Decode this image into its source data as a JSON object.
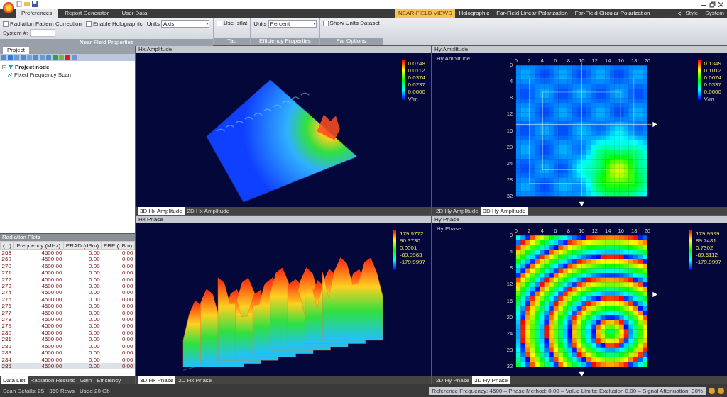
{
  "ribbon": {
    "tabs": [
      {
        "label": "Preferences",
        "selected": true
      },
      {
        "label": "Report Generator",
        "selected": false
      },
      {
        "label": "User Data",
        "selected": false
      }
    ],
    "view_tabs": [
      {
        "label": "NEAR-FIELD VIEWS",
        "selected": true
      },
      {
        "label": "Holographic",
        "selected": false
      },
      {
        "label": "Far-Field Linear Polarization",
        "selected": false
      },
      {
        "label": "Far-Field Circular Polarization",
        "selected": false
      }
    ],
    "right_menu": [
      "Style",
      "System"
    ],
    "groups": [
      {
        "label": "Near-Field Properties",
        "controls": [
          {
            "kind": "checkbox",
            "label": "Radiation Pattern Correction",
            "checked": false
          },
          {
            "kind": "checkbox",
            "label": "Enable Holographic",
            "checked": false
          },
          {
            "kind": "dropdown",
            "label": "Units",
            "value": "Axis"
          },
          {
            "kind": "field",
            "label": "System #:"
          }
        ]
      },
      {
        "label": "Tab",
        "controls": [
          {
            "kind": "checkbox",
            "label": "Use Isflat",
            "checked": false
          }
        ]
      },
      {
        "label": "Efficiency Properties",
        "controls": [
          {
            "kind": "dropdown",
            "label": "Units",
            "value": "Percent"
          }
        ]
      },
      {
        "label": "Far Options",
        "controls": [
          {
            "kind": "checkbox",
            "label": "Show Units Dataset",
            "checked": false
          }
        ]
      }
    ]
  },
  "project_panel": {
    "tab": "Project",
    "tree": [
      {
        "label": "Project node",
        "expanded": true,
        "children": [
          {
            "label": "Fixed Frequency Scan"
          }
        ]
      }
    ]
  },
  "results_panel": {
    "title": "Radiation Plots",
    "columns": [
      "(...)",
      "Frequency (MHz)",
      "PRAD (dBm)",
      "ERP (dBm)"
    ],
    "rows": [
      {
        "cells": [
          "268",
          "4500.00",
          "0.00",
          "0.00"
        ],
        "selected": false
      },
      {
        "cells": [
          "269",
          "4500.00",
          "0.00",
          "0.00"
        ],
        "selected": false
      },
      {
        "cells": [
          "270",
          "4500.00",
          "0.00",
          "0.00"
        ],
        "selected": false
      },
      {
        "cells": [
          "271",
          "4500.00",
          "0.00",
          "0.00"
        ],
        "selected": false
      },
      {
        "cells": [
          "272",
          "4500.00",
          "0.00",
          "0.00"
        ],
        "selected": false
      },
      {
        "cells": [
          "273",
          "4500.00",
          "0.00",
          "0.00"
        ],
        "selected": false
      },
      {
        "cells": [
          "274",
          "4500.00",
          "0.00",
          "0.00"
        ],
        "selected": false
      },
      {
        "cells": [
          "275",
          "4500.00",
          "0.00",
          "0.00"
        ],
        "selected": false
      },
      {
        "cells": [
          "276",
          "4500.00",
          "0.00",
          "0.00"
        ],
        "selected": false
      },
      {
        "cells": [
          "277",
          "4500.00",
          "0.00",
          "0.00"
        ],
        "selected": false
      },
      {
        "cells": [
          "278",
          "4500.00",
          "0.00",
          "0.00"
        ],
        "selected": false
      },
      {
        "cells": [
          "279",
          "4500.00",
          "0.00",
          "0.00"
        ],
        "selected": false
      },
      {
        "cells": [
          "280",
          "4500.00",
          "0.00",
          "0.00"
        ],
        "selected": false
      },
      {
        "cells": [
          "281",
          "4500.00",
          "0.00",
          "0.00"
        ],
        "selected": false
      },
      {
        "cells": [
          "282",
          "4500.00",
          "0.00",
          "0.00"
        ],
        "selected": false
      },
      {
        "cells": [
          "283",
          "4500.00",
          "0.00",
          "0.00"
        ],
        "selected": false
      },
      {
        "cells": [
          "284",
          "4500.00",
          "0.00",
          "0.00"
        ],
        "selected": false
      },
      {
        "cells": [
          "285",
          "4500.00",
          "0.00",
          "0.00"
        ],
        "selected": true
      }
    ],
    "tabs": [
      {
        "label": "Data List",
        "selected": true
      },
      {
        "label": "Radiation Results",
        "selected": false
      },
      {
        "label": "Gain",
        "selected": false
      },
      {
        "label": "Efficiency",
        "selected": false
      }
    ]
  },
  "plots": [
    {
      "title": "Hx Amplitude",
      "kind": "surface_amplitude",
      "legend": [
        "0.0748",
        "0.0112",
        "0.0374",
        "0.0237",
        "0.0000"
      ],
      "unit": "V/m",
      "tabs": [
        {
          "label": "3D Hx Amplitude",
          "selected": true
        },
        {
          "label": "2D Hx Amplitude",
          "selected": false
        }
      ]
    },
    {
      "title": "Hy Amplitude",
      "caption": "Hy Amplitude",
      "kind": "heatmap_amplitude",
      "legend": [
        "0.1349",
        "0.1012",
        "0.0674",
        "0.0337",
        "0.0000"
      ],
      "unit": "V/m",
      "x_ticks": [
        "0",
        "2",
        "4",
        "6",
        "8",
        "10",
        "12",
        "14",
        "16",
        "18",
        "20"
      ],
      "y_ticks": [
        "0",
        "4",
        "8",
        "12",
        "16",
        "20",
        "24",
        "28",
        "32"
      ],
      "tabs": [
        {
          "label": "2D Hy Amplitude",
          "selected": false
        },
        {
          "label": "3D Hy Amplitude",
          "selected": true
        }
      ]
    },
    {
      "title": "Hx Phase",
      "kind": "surface_phase",
      "legend": [
        "179.9772",
        "90.3730",
        "0.0001",
        "-89.9963",
        "-179.9997"
      ],
      "tabs": [
        {
          "label": "3D Hx Phase",
          "selected": true
        },
        {
          "label": "2D Hx Phase",
          "selected": false
        }
      ]
    },
    {
      "title": "Hy Phase",
      "caption": "Hy Phase",
      "kind": "heatmap_phase",
      "legend": [
        "179.9999",
        "89.7481",
        "0.7302",
        "-89.6112",
        "-179.9997"
      ],
      "x_ticks": [
        "0",
        "2",
        "4",
        "6",
        "8",
        "10",
        "12",
        "14",
        "16",
        "18",
        "20"
      ],
      "y_ticks": [
        "0",
        "4",
        "8",
        "12",
        "16",
        "20",
        "24",
        "28",
        "32"
      ],
      "tabs": [
        {
          "label": "2D Hy Phase",
          "selected": false
        },
        {
          "label": "3D Hy Phase",
          "selected": true
        }
      ]
    }
  ],
  "status_bar": {
    "left": "Scan Details: 25 · 360 Rows · Used 20 Gb",
    "right": "Reference Frequency: 4500 – Phase Method: 0.00 – Value Limits: Exclusion 0.00 – Signal Attenuation: 30%"
  }
}
